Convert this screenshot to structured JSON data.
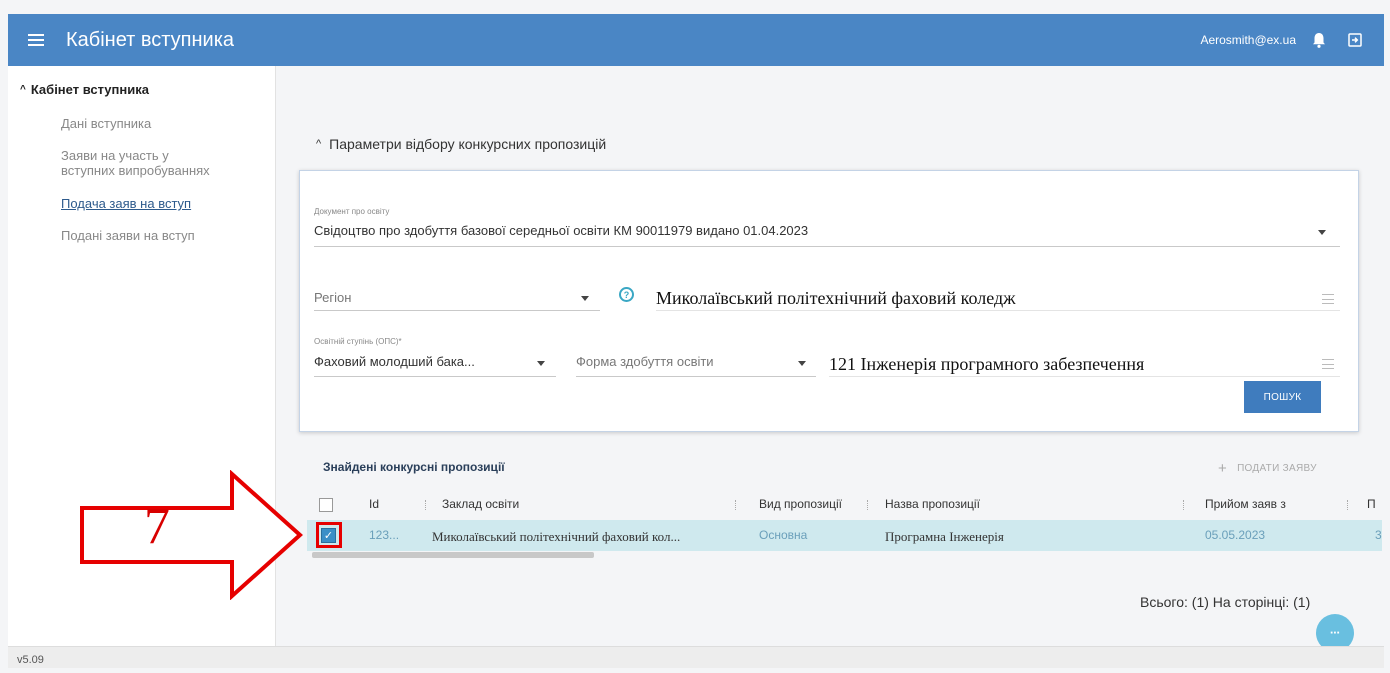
{
  "header": {
    "app_title": "Кабінет вступника",
    "user_email": "Aerosmith@ex.ua",
    "icons": {
      "menu": "menu-icon",
      "bell": "bell-icon",
      "exit": "exit-icon"
    }
  },
  "sidebar": {
    "header": "Кабінет вступника",
    "items": [
      {
        "label_lines": [
          "Дані вступника"
        ],
        "active": false
      },
      {
        "label_lines": [
          "Заяви на участь у",
          "вступних випробуваннях"
        ],
        "active": false
      },
      {
        "label_lines": [
          "Подача заяв на вступ"
        ],
        "active": true
      },
      {
        "label_lines": [
          "Подані заяви на вступ"
        ],
        "active": false
      }
    ]
  },
  "params": {
    "header": "Параметри відбору конкурсних пропозицій",
    "document_label": "Документ про освіту",
    "document_value": "Свідоцтво про здобуття базової середньої освіти КМ 90011979 видано 01.04.2023",
    "region_placeholder": "Регіон",
    "institution": "Миколаївський політехнічний фаховий коледж",
    "degree_label": "Освітній ступінь (ОПС)*",
    "degree_value": "Фаховий молодший бака...",
    "study_form_placeholder": "Форма здобуття освіти",
    "specialty": "121 Інженерія програмного забезпечення",
    "search_button": "ПОШУК"
  },
  "results": {
    "title": "Знайдені конкурсні пропозиції",
    "submit_button": "ПОДАТИ ЗАЯВУ",
    "columns": [
      "Id",
      "Заклад освіти",
      "Вид пропозиції",
      "Назва пропозиції",
      "Прийом заяв з",
      "П"
    ],
    "rows": [
      {
        "id": "123...",
        "institution": "Миколаївський політехнічний фаховий кол...",
        "offer_type": "Основна",
        "offer_name": "Програмна Інженерія",
        "accept_from": "05.05.2023",
        "next": "3",
        "checked": true
      }
    ],
    "pager": "Всього: (1) На сторінці: (1)"
  },
  "annotation": {
    "step_number": "7",
    "color": "#e60000"
  },
  "footer": {
    "version": "v5.09"
  },
  "colors": {
    "header_bg": "#4a86c5",
    "row_selected": "#cfe9ee",
    "button": "#3f7cbe"
  }
}
